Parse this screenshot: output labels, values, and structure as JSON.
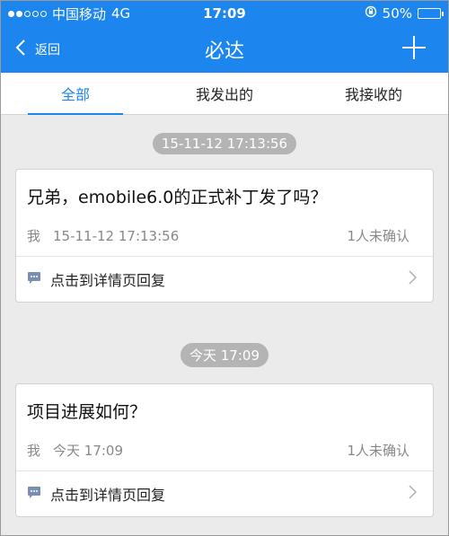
{
  "status_bar": {
    "carrier": "中国移动",
    "network": "4G",
    "time": "17:09",
    "battery": "50%",
    "battery_level": 0.5
  },
  "nav": {
    "back_label": "返回",
    "title": "必达"
  },
  "tabs": [
    {
      "label": "全部"
    },
    {
      "label": "我发出的"
    },
    {
      "label": "我接收的"
    }
  ],
  "messages": [
    {
      "time_divider": "15-11-12 17:13:56",
      "title": "兄弟，emobile6.0的正式补丁发了吗？",
      "sender": "我",
      "timestamp": "15-11-12 17:13:56",
      "status": "1人未确认",
      "reply_label": "点击到详情页回复"
    },
    {
      "time_divider": "今天 17:09",
      "title": "项目进展如何？",
      "sender": "我",
      "timestamp": "今天 17:09",
      "status": "1人未确认",
      "reply_label": "点击到详情页回复"
    }
  ],
  "colors": {
    "accent": "#1c86ee",
    "background": "#ebebeb"
  }
}
